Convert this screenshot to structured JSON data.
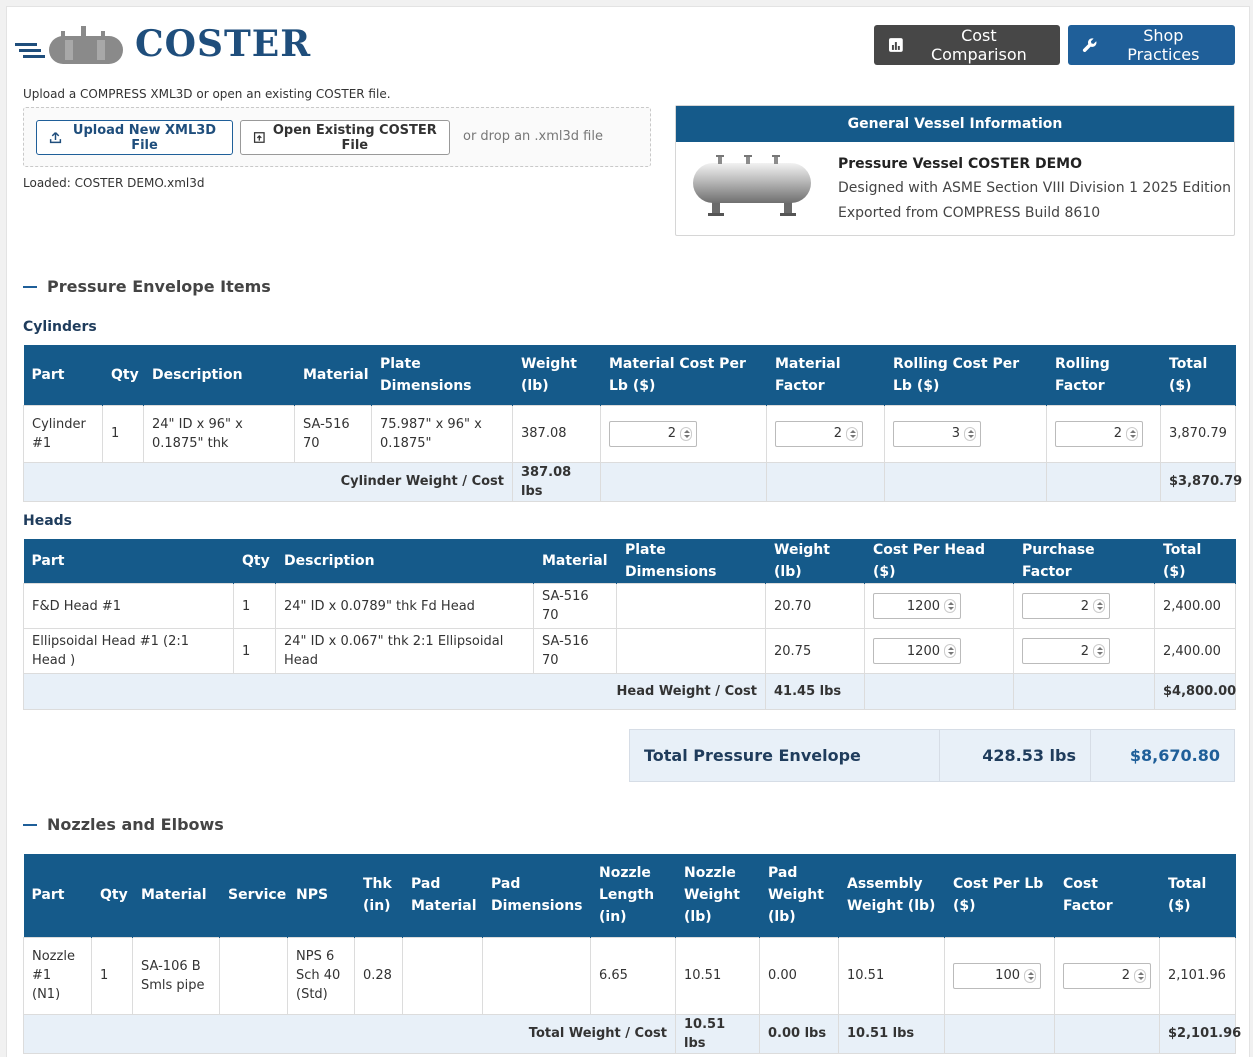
{
  "header": {
    "logo_text": "COSTER",
    "cost_comparison_label": "Cost Comparison",
    "shop_practices_label": "Shop Practices"
  },
  "upload": {
    "hint": "Upload a COMPRESS XML3D or open an existing COSTER file.",
    "upload_label": "Upload New XML3D File",
    "open_label": "Open Existing COSTER File",
    "drop_text": "or drop an .xml3d file",
    "loaded": "Loaded: COSTER DEMO.xml3d"
  },
  "vessel": {
    "panel_title": "General Vessel Information",
    "name": "Pressure Vessel COSTER DEMO",
    "designed": "Designed with ASME Section VIII Division 1 2025 Edition",
    "exported": "Exported from COMPRESS Build 8610"
  },
  "pressure_envelope": {
    "title": "Pressure Envelope Items",
    "cylinders": {
      "title": "Cylinders",
      "headers": [
        "Part",
        "Qty",
        "Description",
        "Material",
        "Plate Dimensions",
        "Weight (lb)",
        "Material Cost Per Lb ($)",
        "Material Factor",
        "Rolling Cost Per Lb ($)",
        "Rolling Factor",
        "Total ($)"
      ],
      "rows": [
        {
          "part": "Cylinder #1",
          "qty": "1",
          "description": "24\" ID x 96\" x 0.1875\" thk",
          "material": "SA-516 70",
          "plate": "75.987\" x 96\" x 0.1875\"",
          "weight": "387.08",
          "mat_cost": "2",
          "mat_factor": "2",
          "roll_cost": "3",
          "roll_factor": "2",
          "total": "3,870.79"
        }
      ],
      "summary_label": "Cylinder Weight / Cost",
      "summary_weight": "387.08 lbs",
      "summary_total": "$3,870.79"
    },
    "heads": {
      "title": "Heads",
      "headers": [
        "Part",
        "Qty",
        "Description",
        "Material",
        "Plate Dimensions",
        "Weight (lb)",
        "Cost Per Head ($)",
        "Purchase Factor",
        "Total ($)"
      ],
      "rows": [
        {
          "part": "F&D Head #1",
          "qty": "1",
          "description": "24\" ID x 0.0789\" thk Fd Head",
          "material": "SA-516 70",
          "plate": "",
          "weight": "20.70",
          "cost": "1200",
          "factor": "2",
          "total": "2,400.00"
        },
        {
          "part": "Ellipsoidal Head #1 (2:1 Head )",
          "qty": "1",
          "description": "24\" ID x 0.067\" thk 2:1 Ellipsoidal Head",
          "material": "SA-516 70",
          "plate": "",
          "weight": "20.75",
          "cost": "1200",
          "factor": "2",
          "total": "2,400.00"
        }
      ],
      "summary_label": "Head Weight / Cost",
      "summary_weight": "41.45 lbs",
      "summary_total": "$4,800.00"
    },
    "total": {
      "label": "Total Pressure Envelope",
      "weight": "428.53 lbs",
      "cost": "$8,670.80"
    }
  },
  "nozzles": {
    "title": "Nozzles and Elbows",
    "headers": [
      "Part",
      "Qty",
      "Material",
      "Service",
      "NPS",
      "Thk (in)",
      "Pad Material",
      "Pad Dimensions",
      "Nozzle Length (in)",
      "Nozzle Weight (lb)",
      "Pad Weight (lb)",
      "Assembly Weight (lb)",
      "Cost Per Lb ($)",
      "Cost Factor",
      "Total ($)"
    ],
    "rows": [
      {
        "part": "Nozzle #1 (N1)",
        "qty": "1",
        "material": "SA-106 B Smls pipe",
        "service": "",
        "nps": "NPS 6 Sch 40 (Std)",
        "thk": "0.28",
        "pad_material": "",
        "pad_dims": "",
        "length": "6.65",
        "nozzle_weight": "10.51",
        "pad_weight": "0.00",
        "assembly_weight": "10.51",
        "cost_per_lb": "100",
        "cost_factor": "2",
        "total": "2,101.96"
      }
    ],
    "summary_label": "Total Weight / Cost",
    "summary_nozzle_weight": "10.51 lbs",
    "summary_pad_weight": "0.00 lbs",
    "summary_assembly_weight": "10.51 lbs",
    "summary_total": "$2,101.96"
  },
  "colors": {
    "header_blue": "#155a8a",
    "summary_bg": "#e8f0f8",
    "dark_button": "#474747",
    "brand_blue": "#1f4e7c"
  },
  "icons": [
    "logo-vessel-icon",
    "chart-icon",
    "wrench-icon",
    "upload-icon",
    "open-file-icon",
    "vessel-image",
    "spinner-icon"
  ]
}
